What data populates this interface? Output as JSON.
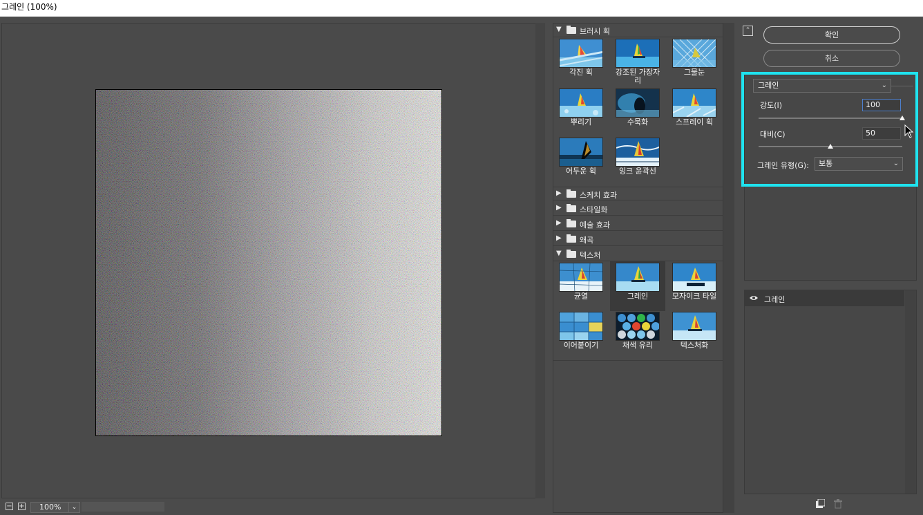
{
  "window": {
    "title": "그레인 (100%)"
  },
  "preview": {
    "zoom_value": "100%",
    "zoom_out_icon": "minus-icon",
    "zoom_in_icon": "plus-icon"
  },
  "gallery": {
    "folders": [
      {
        "label": "브러시 획",
        "expanded": true
      },
      {
        "label": "스케치 효과",
        "expanded": false
      },
      {
        "label": "스타일화",
        "expanded": false
      },
      {
        "label": "예술 효과",
        "expanded": false
      },
      {
        "label": "왜곡",
        "expanded": false
      },
      {
        "label": "텍스처",
        "expanded": true
      }
    ],
    "brush_thumbs": [
      {
        "label": "각진 획"
      },
      {
        "label": "강조된 가장자\n리"
      },
      {
        "label": "그물눈"
      },
      {
        "label": "뿌리기"
      },
      {
        "label": "수묵화"
      },
      {
        "label": "스프레이 획"
      },
      {
        "label": "어두운 획"
      },
      {
        "label": "잉크 윤곽선"
      }
    ],
    "texture_thumbs": [
      {
        "label": "균열"
      },
      {
        "label": "그레인",
        "selected": true
      },
      {
        "label": "모자이크 타일"
      },
      {
        "label": "이어붙이기"
      },
      {
        "label": "채색 유리"
      },
      {
        "label": "텍스처화"
      }
    ]
  },
  "actions": {
    "ok_label": "확인",
    "cancel_label": "취소"
  },
  "settings": {
    "filter_name": "그레인",
    "intensity_label": "강도(I)",
    "intensity_value": "100",
    "intensity_level": 1.0,
    "contrast_label": "대비(C)",
    "contrast_value": "50",
    "contrast_level": 0.5,
    "grain_type_label": "그레인 유형(G):",
    "grain_type_value": "보통"
  },
  "layers": {
    "items": [
      {
        "name": "그레인",
        "visible": true
      }
    ]
  },
  "colors": {
    "highlight_border": "#1fe3ef",
    "panel_bg": "#4b4b4b"
  }
}
